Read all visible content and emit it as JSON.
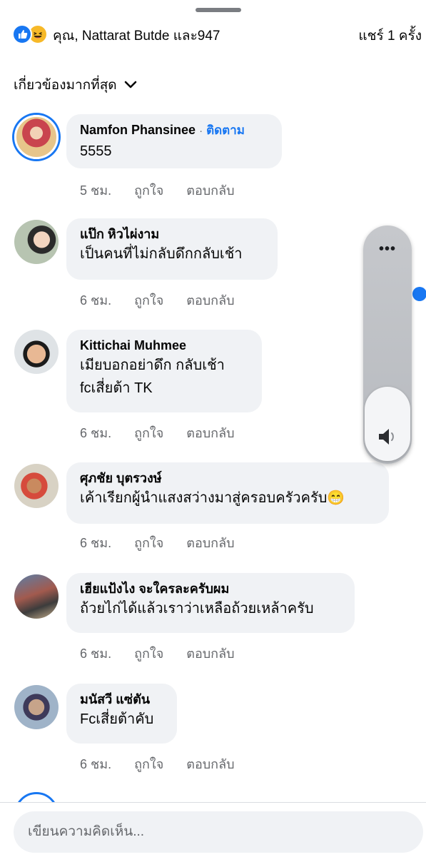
{
  "header": {
    "reaction_icons": [
      "like-icon",
      "haha-icon"
    ],
    "reactors_text": "คุณ, Nattarat Butde และ947",
    "shares_text": "แชร์ 1 ครั้ง"
  },
  "sort": {
    "label": "เกี่ยวข้องมากที่สุด",
    "icon": "chevron-down-icon"
  },
  "comments": [
    {
      "author": "Namfon Phansinee",
      "follow": "ติดตาม",
      "text": [
        "5555"
      ],
      "time": "5 ชม.",
      "like": "ถูกใจ",
      "reply": "ตอบกลับ"
    },
    {
      "author": "แป๊ก หิวไผ่งาม",
      "text": [
        "เป็นคนที่ไม่กลับดึกกลับเช้า"
      ],
      "time": "6 ชม.",
      "like": "ถูกใจ",
      "reply": "ตอบกลับ"
    },
    {
      "author": "Kittichai Muhmee",
      "text": [
        "เมียบอกอย่าดึก กลับเช้า",
        "fcเสี่ยต้า TK"
      ],
      "time": "6 ชม.",
      "like": "ถูกใจ",
      "reply": "ตอบกลับ"
    },
    {
      "author": "ศุภชัย บุตรวงษ์",
      "text": [
        "เค้าเรียกผู้นำแสงสว่างมาสู่ครอบครัวครับ😁"
      ],
      "time": "6 ชม.",
      "like": "ถูกใจ",
      "reply": "ตอบกลับ"
    },
    {
      "author": "เฮียแป้งไง จะใครละครับผม",
      "text": [
        "ถ้วยไก่ได้แล้วเราว่าเหลือถ้วยเหล้าครับ"
      ],
      "time": "6 ชม.",
      "like": "ถูกใจ",
      "reply": "ตอบกลับ"
    },
    {
      "author": "มนัสวี แซ่ตัน",
      "text": [
        "Fcเสี่ยต้าคับ"
      ],
      "time": "6 ชม.",
      "like": "ถูกใจ",
      "reply": "ตอบกลับ"
    }
  ],
  "composer": {
    "placeholder": "เขียนความคิดเห็น..."
  },
  "side_panel": {
    "menu_icon": "more-dots-icon",
    "volume_icon": "speaker-icon",
    "dots": "•••"
  },
  "colors": {
    "accent": "#1877f2",
    "bubble": "#f0f2f5",
    "meta": "#65676b"
  }
}
